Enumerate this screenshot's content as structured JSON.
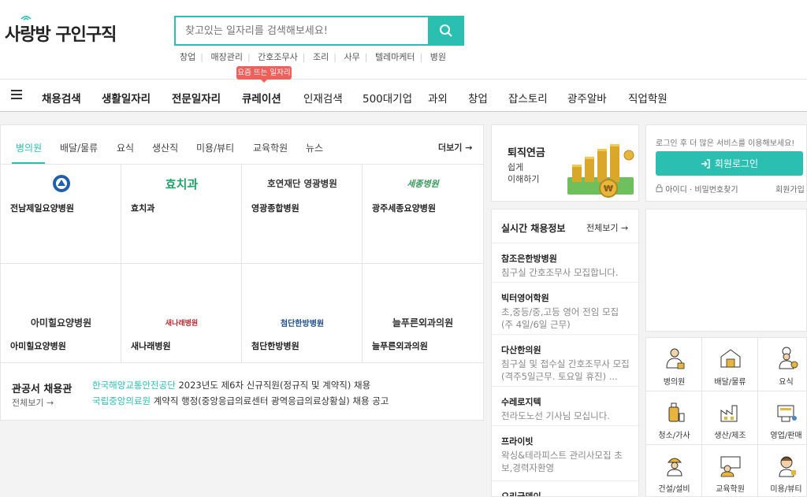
{
  "header": {
    "logo_text": "사랑방 구인구직",
    "search_placeholder": "찾고있는 일자리를 검색해보세요!",
    "keywords": [
      "창업",
      "매장관리",
      "간호조무사",
      "조리",
      "사무",
      "텔레마케터",
      "병원"
    ]
  },
  "nav": {
    "badge": "요즘 뜨는 일자리",
    "items": [
      "채용검색",
      "생활일자리",
      "전문일자리",
      "큐레이션",
      "인재검색",
      "500대기업",
      "과외",
      "창업",
      "잡스토리",
      "광주알바",
      "직업학원"
    ]
  },
  "main": {
    "tabs": [
      "병의원",
      "배달/물류",
      "요식",
      "생산직",
      "미용/뷰티",
      "교육학원",
      "뉴스"
    ],
    "more_label": "더보기",
    "companies": [
      {
        "logo": "",
        "name": "전남제일요양병원"
      },
      {
        "logo": "효치과",
        "name": "효치과"
      },
      {
        "logo": "호연재단 영광병원",
        "name": "영광종합병원"
      },
      {
        "logo": "세종병원",
        "name": "광주세종요양병원"
      },
      {
        "logo": "아미힐요양병원",
        "name": "아미힐요양병원"
      },
      {
        "logo": "새나래병원",
        "name": "새나래병원"
      },
      {
        "logo": "첨단한방병원",
        "name": "첨단한방병원"
      },
      {
        "logo": "늘푸른외과의원",
        "name": "늘푸른외과의원"
      }
    ],
    "public_title": "관공서 채용관",
    "public_more": "전체보기",
    "public_jobs": [
      {
        "org": "한국해양교통안전공단",
        "text": " 2023년도 제6차 신규직원(정규직 및 계약직) 채용"
      },
      {
        "org": "국립중앙의료원",
        "text": " 계약직 행정(중앙응급의료센터 광역응급의료상황실) 채용 공고"
      }
    ]
  },
  "retire": {
    "title": "퇴직연금",
    "line1": "쉽게",
    "line2": "이해하기"
  },
  "realtime": {
    "title": "실시간 채용정보",
    "more": "전체보기",
    "items": [
      {
        "company": "참조은한방병원",
        "desc": "침구실 간호조무사 모집합니다."
      },
      {
        "company": "빅터영어학원",
        "desc": "초,중등/중,고등 영어 전임 모집 (주 4일/6일 근무)"
      },
      {
        "company": "다산한의원",
        "desc": "침구실 및 접수실 간호조무사 모집(격주5일근무. 토요일 휴진) ..."
      },
      {
        "company": "수레로지텍",
        "desc": "전라도노선 기사님 모십니다."
      },
      {
        "company": "프라이빗",
        "desc": "왁싱&테라피스트 관리사모집 초보,경력자환영"
      },
      {
        "company": "오리궁뎅이",
        "desc": ""
      }
    ]
  },
  "login": {
    "message": "로그인 후 더 많은 서비스를 이용해보세요!",
    "button": "회원로그인",
    "find": "아이디 · 비밀번호찾기",
    "join": "회원가입"
  },
  "categories": [
    "병의원",
    "배달/물류",
    "요식",
    "청소/가사",
    "생산/제조",
    "영업/판매",
    "건설/설비",
    "교육학원",
    "미용/뷰티"
  ],
  "colors": {
    "accent": "#2bbfb2",
    "badge": "#f0605a"
  }
}
